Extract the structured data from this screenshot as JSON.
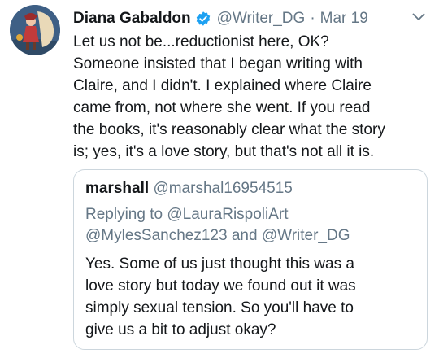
{
  "author": {
    "name": "Diana Gabaldon",
    "handle": "@Writer_DG",
    "separator": "·",
    "date": "Mar 19"
  },
  "tweet": {
    "lines": [
      "Let us not be...reductionist here, OK?",
      "Someone insisted that I began writing with",
      "Claire, and I didn't.  I explained where Claire",
      "came from, not where she went.  If you read",
      "the books, it's reasonably clear what the story",
      "is; yes, it's a love story, but that's not all it is."
    ]
  },
  "quoted": {
    "name": "marshall",
    "handle": "@marshal16954515",
    "replying_prefix": "Replying to",
    "reply_mention_1": "@LauraRispoliArt",
    "reply_mention_2": "@MylesSanchez123",
    "reply_and": "and",
    "reply_mention_3": "@Writer_DG",
    "lines": [
      "Yes.  Some of us just thought this was a",
      "love story but today we found out it was",
      "simply sexual tension.  So you'll have to",
      "give us a bit to adjust okay?"
    ]
  },
  "icons": {
    "verified": "verified-badge-icon",
    "caret": "chevron-down-icon"
  },
  "colors": {
    "text": "#14171a",
    "muted": "#657786",
    "verified": "#1da1f2",
    "border": "#ccd6dd"
  }
}
